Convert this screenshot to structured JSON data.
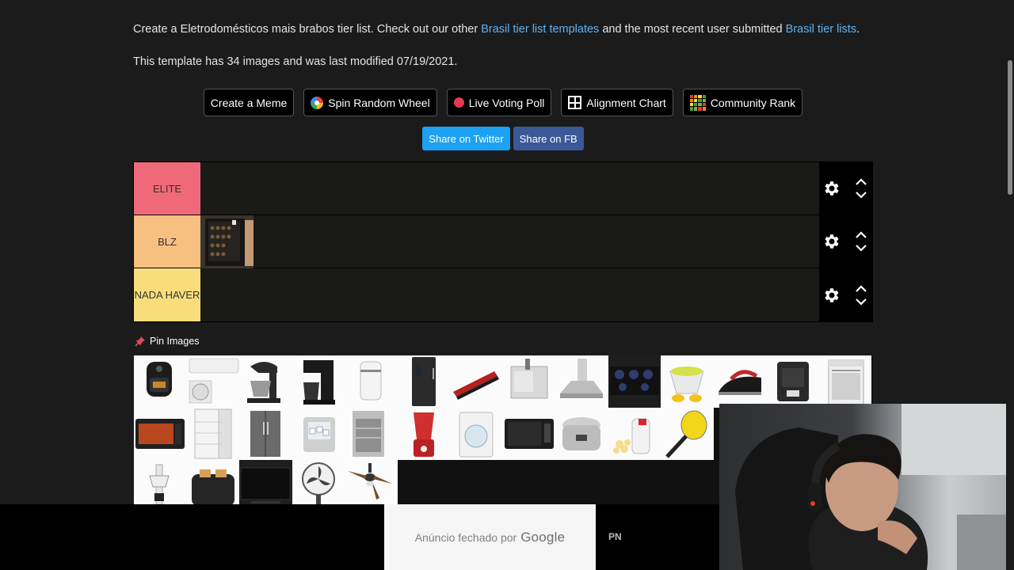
{
  "intro": {
    "prefix": "Create a Eletrodomésticos mais brabos tier list. Check out our other ",
    "link1": "Brasil tier list templates",
    "middle": " and the most recent user submitted ",
    "link2": "Brasil tier lists",
    "suffix": "."
  },
  "meta_text": "This template has 34 images and was last modified 07/19/2021.",
  "toolbar": {
    "create_meme": "Create a Meme",
    "spin_wheel": "Spin Random Wheel",
    "live_poll": "Live Voting Poll",
    "alignment": "Alignment Chart",
    "community": "Community Rank"
  },
  "share": {
    "twitter": "Share on Twitter",
    "fb": "Share on FB"
  },
  "tiers": [
    {
      "label": "ELITE",
      "color": "#f0697a"
    },
    {
      "label": "BLZ",
      "color": "#f7bf80"
    },
    {
      "label": "NADA HAVER",
      "color": "#f9dd7c"
    }
  ],
  "pin_label": "Pin Images",
  "ad": {
    "text": "Anúncio fechado por",
    "brand": "Google",
    "side": "PN"
  },
  "icons": {
    "wheel": "spin-wheel-icon",
    "poll": "live-poll-dot-icon",
    "alignment": "alignment-grid-icon",
    "community": "community-rank-icon",
    "settings": "gear-icon",
    "move_up": "chevron-up-icon",
    "move_down": "chevron-down-icon",
    "pin": "pin-icon"
  },
  "colors": {
    "link": "#5fb3f5",
    "twitter": "#1da1f2",
    "facebook": "#3b5998",
    "background": "#1b1b1b"
  }
}
